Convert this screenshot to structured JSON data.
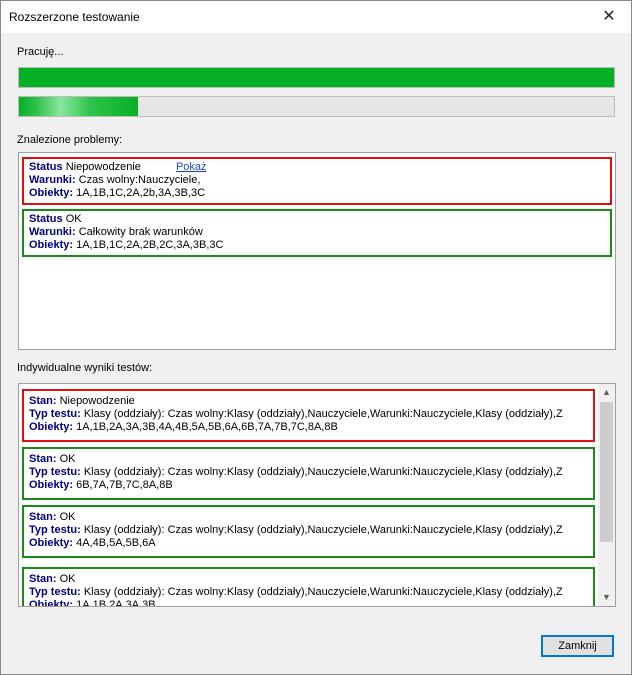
{
  "window": {
    "title": "Rozszerzone testowanie",
    "close_glyph": "✕"
  },
  "status_label": "Pracuję...",
  "progress": {
    "overall_percent": 100,
    "current_percent": 20
  },
  "found_problems": {
    "label": "Znalezione problemy:",
    "items": [
      {
        "status_key": "Status",
        "status_value": "Niepowodzenie",
        "link": "Pokaż",
        "conditions_key": "Warunki:",
        "conditions_value": "Czas wolny:Nauczyciele,",
        "objects_key": "Obiekty:",
        "objects_value": "1A,1B,1C,2A,2b,3A,3B,3C"
      },
      {
        "status_key": "Status",
        "status_value": "OK",
        "conditions_key": "Warunki:",
        "conditions_value": "Całkowity brak warunków",
        "objects_key": "Obiekty:",
        "objects_value": "1A,1B,1C,2A,2B,2C,3A,3B,3C"
      }
    ]
  },
  "individual_results": {
    "label": "Indywidualne wyniki testów:",
    "items": [
      {
        "state_key": "Stan:",
        "state_value": "Niepowodzenie",
        "type_key": "Typ testu:",
        "type_value": "Klasy (oddziały): Czas wolny:Klasy (oddziały),Nauczyciele,Warunki:Nauczyciele,Klasy (oddziały),Z",
        "objects_key": "Obiekty:",
        "objects_value": "1A,1B,2A,3A,3B,4A,4B,5A,5B,6A,6B,7A,7B,7C,8A,8B"
      },
      {
        "state_key": "Stan:",
        "state_value": "OK",
        "type_key": "Typ testu:",
        "type_value": "Klasy (oddziały): Czas wolny:Klasy (oddziały),Nauczyciele,Warunki:Nauczyciele,Klasy (oddziały),Z",
        "objects_key": "Obiekty:",
        "objects_value": "6B,7A,7B,7C,8A,8B"
      },
      {
        "state_key": "Stan:",
        "state_value": "OK",
        "type_key": "Typ testu:",
        "type_value": "Klasy (oddziały): Czas wolny:Klasy (oddziały),Nauczyciele,Warunki:Nauczyciele,Klasy (oddziały),Z",
        "objects_key": "Obiekty:",
        "objects_value": "4A,4B,5A,5B,6A"
      },
      {
        "state_key": "Stan:",
        "state_value": "OK",
        "type_key": "Typ testu:",
        "type_value": "Klasy (oddziały): Czas wolny:Klasy (oddziały),Nauczyciele,Warunki:Nauczyciele,Klasy (oddziały),Z",
        "objects_key": "Obiekty:",
        "objects_value": "1A,1B,2A,3A,3B"
      }
    ]
  },
  "scroll": {
    "up_glyph": "▲",
    "down_glyph": "▼"
  },
  "buttons": {
    "close_label": "Zamknij"
  }
}
